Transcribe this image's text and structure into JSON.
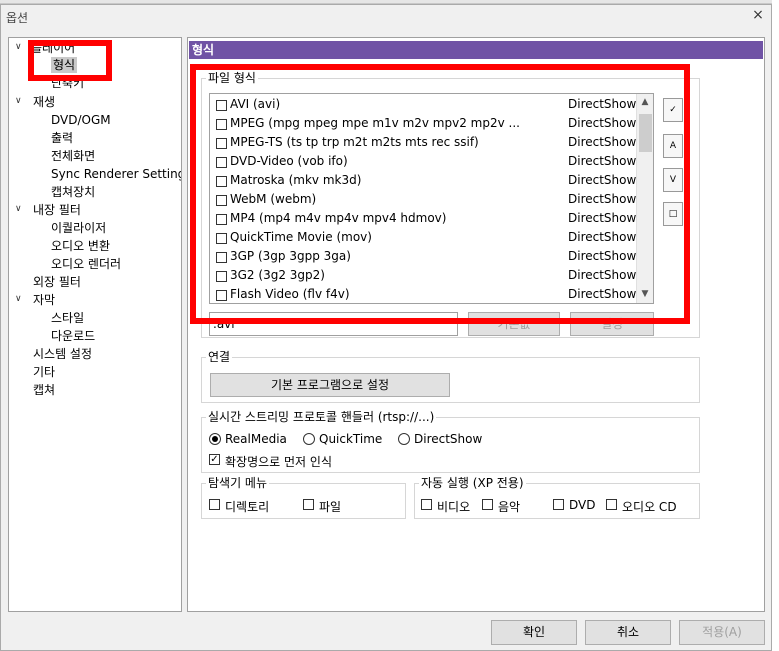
{
  "window": {
    "title": "옵션",
    "close_glyph": "×"
  },
  "tree": {
    "items": [
      {
        "label": "플레이어",
        "level": 0,
        "expanded": true
      },
      {
        "label": "형식",
        "level": 1,
        "selected": true
      },
      {
        "label": "단축키",
        "level": 1
      },
      {
        "label": "재생",
        "level": 0,
        "expanded": true
      },
      {
        "label": "DVD/OGM",
        "level": 1
      },
      {
        "label": "출력",
        "level": 1
      },
      {
        "label": "전체화면",
        "level": 1
      },
      {
        "label": "Sync Renderer Settings",
        "level": 1
      },
      {
        "label": "캡쳐장치",
        "level": 1
      },
      {
        "label": "내장 필터",
        "level": 0,
        "expanded": true
      },
      {
        "label": "이퀄라이저",
        "level": 1
      },
      {
        "label": "오디오 변환",
        "level": 1
      },
      {
        "label": "오디오 렌더러",
        "level": 1
      },
      {
        "label": "외장 필터",
        "level": 0
      },
      {
        "label": "자막",
        "level": 0,
        "expanded": true
      },
      {
        "label": "스타일",
        "level": 1
      },
      {
        "label": "다운로드",
        "level": 1
      },
      {
        "label": "시스템 설정",
        "level": 0
      },
      {
        "label": "기타",
        "level": 0
      },
      {
        "label": "캡쳐",
        "level": 0
      }
    ]
  },
  "page_header": "형식",
  "file_formats": {
    "group_label": "파일 형식",
    "rows": [
      {
        "name": "AVI (avi)",
        "provider": "DirectShow"
      },
      {
        "name": "MPEG (mpg mpeg mpe m1v m2v mpv2 mp2v ...",
        "provider": "DirectShow"
      },
      {
        "name": "MPEG-TS (ts tp trp m2t m2ts mts rec ssif)",
        "provider": "DirectShow"
      },
      {
        "name": "DVD-Video (vob ifo)",
        "provider": "DirectShow"
      },
      {
        "name": "Matroska (mkv mk3d)",
        "provider": "DirectShow"
      },
      {
        "name": "WebM (webm)",
        "provider": "DirectShow"
      },
      {
        "name": "MP4 (mp4 m4v mp4v mpv4 hdmov)",
        "provider": "DirectShow"
      },
      {
        "name": "QuickTime Movie (mov)",
        "provider": "DirectShow"
      },
      {
        "name": "3GP (3gp 3gpp 3ga)",
        "provider": "DirectShow"
      },
      {
        "name": "3G2 (3g2 3gp2)",
        "provider": "DirectShow"
      },
      {
        "name": "Flash Video (flv f4v)",
        "provider": "DirectShow"
      }
    ],
    "extension_value": ".avi",
    "default_button": "기본값",
    "set_button": "설정"
  },
  "association": {
    "group_label": "연결",
    "default_program_button": "기본 프로그램으로 설정"
  },
  "streaming": {
    "group_label": "실시간 스트리밍 프로토콜 핸들러 (rtsp://...)",
    "options": [
      "RealMedia",
      "QuickTime",
      "DirectShow"
    ],
    "selected": "RealMedia",
    "check_ext_label": "확장명으로 먼저 인식",
    "check_ext_checked": true
  },
  "explorer_menu": {
    "group_label": "탐색기 메뉴",
    "items": [
      "디렉토리",
      "파일"
    ]
  },
  "autoplay": {
    "group_label": "자동 실행 (XP 전용)",
    "items": [
      "비디오",
      "음악",
      "DVD",
      "오디오 CD"
    ]
  },
  "footer": {
    "ok": "확인",
    "cancel": "취소",
    "apply": "적용(A)"
  },
  "colors": {
    "header_bg": "#7053a5",
    "highlight_box": "#ff0000"
  }
}
